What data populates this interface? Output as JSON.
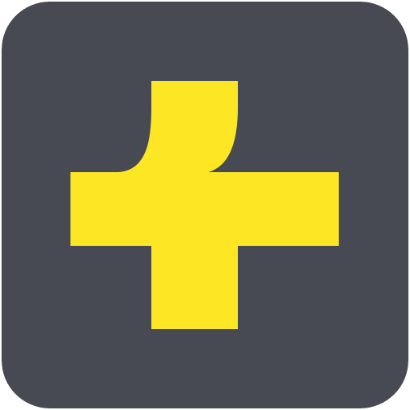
{
  "app_icon": {
    "name": "plus-cross-logo",
    "colors": {
      "background": "#474A53",
      "glyph": "#FDE725"
    }
  }
}
